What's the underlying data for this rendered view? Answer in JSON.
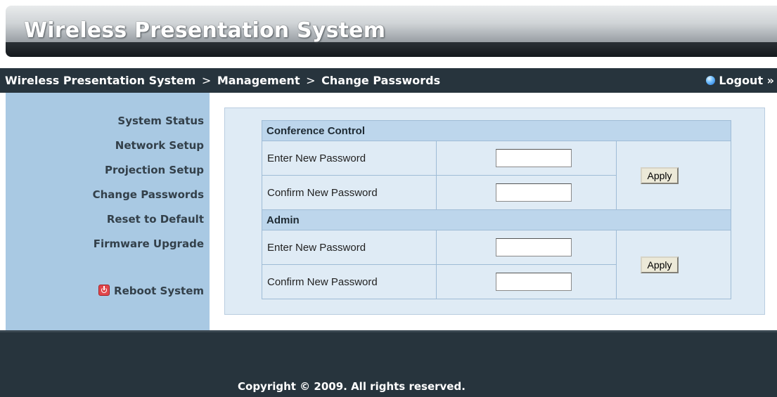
{
  "app": {
    "title": "Wireless Presentation System"
  },
  "breadcrumb": {
    "items": [
      "Wireless Presentation System",
      "Management",
      "Change Passwords"
    ],
    "separator": ">"
  },
  "logout": {
    "label": "Logout »"
  },
  "sidebar": {
    "items": [
      {
        "label": "System Status"
      },
      {
        "label": "Network Setup"
      },
      {
        "label": "Projection Setup"
      },
      {
        "label": "Change Passwords"
      },
      {
        "label": "Reset to Default"
      },
      {
        "label": "Firmware Upgrade"
      }
    ],
    "reboot_label": "Reboot System"
  },
  "sections": [
    {
      "title": "Conference Control",
      "fields": [
        {
          "label": "Enter New Password",
          "value": ""
        },
        {
          "label": "Confirm New Password",
          "value": ""
        }
      ],
      "apply_label": "Apply"
    },
    {
      "title": "Admin",
      "fields": [
        {
          "label": "Enter New Password",
          "value": ""
        },
        {
          "label": "Confirm New Password",
          "value": ""
        }
      ],
      "apply_label": "Apply"
    }
  ],
  "footer": {
    "copyright": "Copyright © 2009. All rights reserved."
  },
  "colors": {
    "header_bg": "#27343d",
    "sidebar_bg": "#a9c9e3",
    "panel_bg": "#dfebf5",
    "section_header_bg": "#bdd6ec"
  }
}
